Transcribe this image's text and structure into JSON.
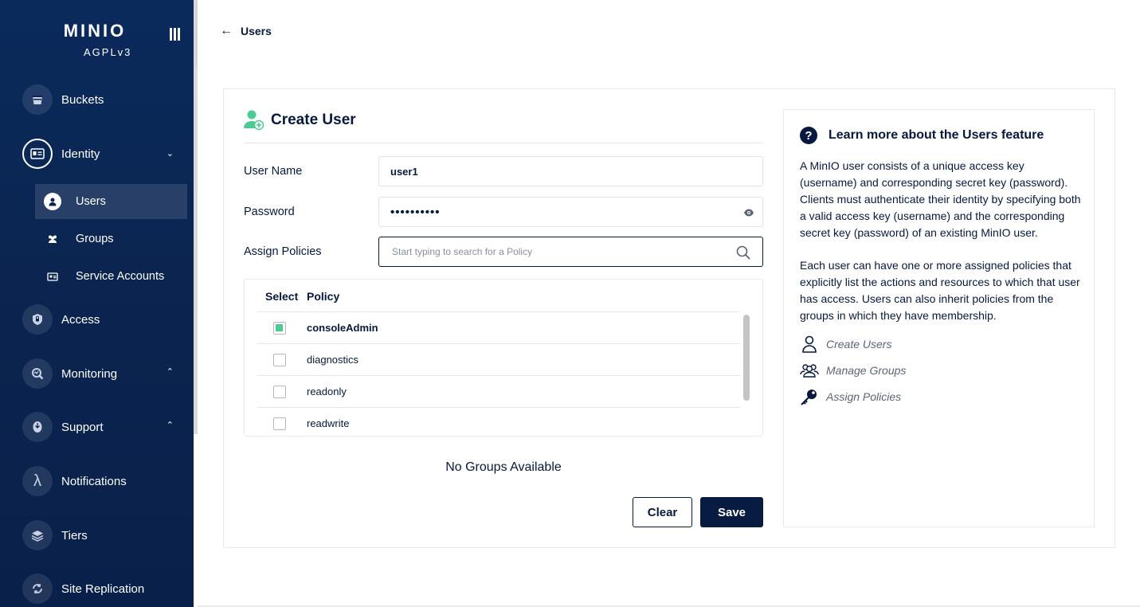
{
  "sidebar": {
    "logo": "MINIO",
    "license": "AGPLv3",
    "items": [
      {
        "label": "Buckets"
      },
      {
        "label": "Identity"
      },
      {
        "label": "Access"
      },
      {
        "label": "Monitoring"
      },
      {
        "label": "Support"
      },
      {
        "label": "Notifications"
      },
      {
        "label": "Tiers"
      },
      {
        "label": "Site Replication"
      }
    ],
    "identity_sub": [
      {
        "label": "Users"
      },
      {
        "label": "Groups"
      },
      {
        "label": "Service Accounts"
      }
    ]
  },
  "header": {
    "back_label": "Users"
  },
  "form": {
    "title": "Create User",
    "username_label": "User Name",
    "username_value": "user1",
    "password_label": "Password",
    "password_value": "••••••••••",
    "policies_label": "Assign Policies",
    "policies_placeholder": "Start typing to search for a Policy",
    "table": {
      "col_select": "Select",
      "col_policy": "Policy",
      "rows": [
        {
          "name": "consoleAdmin",
          "checked": true
        },
        {
          "name": "diagnostics",
          "checked": false
        },
        {
          "name": "readonly",
          "checked": false
        },
        {
          "name": "readwrite",
          "checked": false
        }
      ]
    },
    "no_groups": "No Groups Available",
    "clear_label": "Clear",
    "save_label": "Save"
  },
  "help": {
    "title": "Learn more about the Users feature",
    "para1": "A MinIO user consists of a unique access key (username) and corresponding secret key (password). Clients must authenticate their identity by specifying both a valid access key (username) and the corresponding secret key (password) of an existing MinIO user.",
    "para2": "Each user can have one or more assigned policies that explicitly list the actions and resources to which that user has access. Users can also inherit policies from the groups in which they have membership.",
    "links": [
      {
        "label": "Create Users",
        "icon": "user-icon"
      },
      {
        "label": "Manage Groups",
        "icon": "group-icon"
      },
      {
        "label": "Assign Policies",
        "icon": "key-icon"
      }
    ]
  },
  "colors": {
    "sidebar_bg": "#0b2550",
    "primary": "#07193e",
    "accent_green": "#4ccb92"
  }
}
